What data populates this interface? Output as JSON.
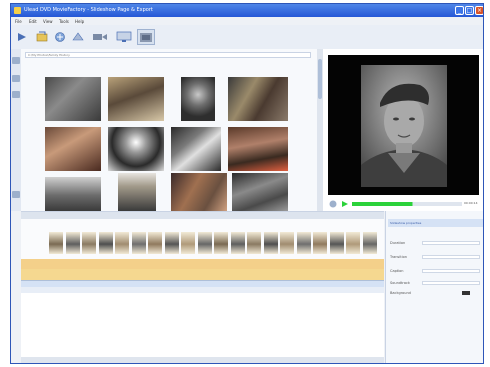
{
  "window": {
    "title": "Ulead DVD MovieFactory - Slideshow Page & Export",
    "controls": {
      "minimize": "_",
      "maximize": "□",
      "close": "×"
    }
  },
  "menu": [
    "File",
    "Edit",
    "View",
    "Tools",
    "Help"
  ],
  "toolbar": {
    "icons": [
      "capture-icon",
      "open-icon",
      "add-media-icon",
      "settings-icon",
      "record-icon",
      "monitor-icon"
    ]
  },
  "browser": {
    "path": "C:\\My Photos\\Family History"
  },
  "preview": {
    "progress": 0.55,
    "timecode": "00:00:14"
  },
  "storyboard": {
    "frame_count": 20
  },
  "properties": {
    "header": "Slideshow properties",
    "rows": [
      "Duration",
      "Transition",
      "Caption",
      "Soundtrack",
      "Background"
    ]
  },
  "colors": {
    "titlebar": "#2557d6",
    "accent": "#3c74e6",
    "audio_track": "#f4d08a",
    "progress": "#2bd23a"
  }
}
